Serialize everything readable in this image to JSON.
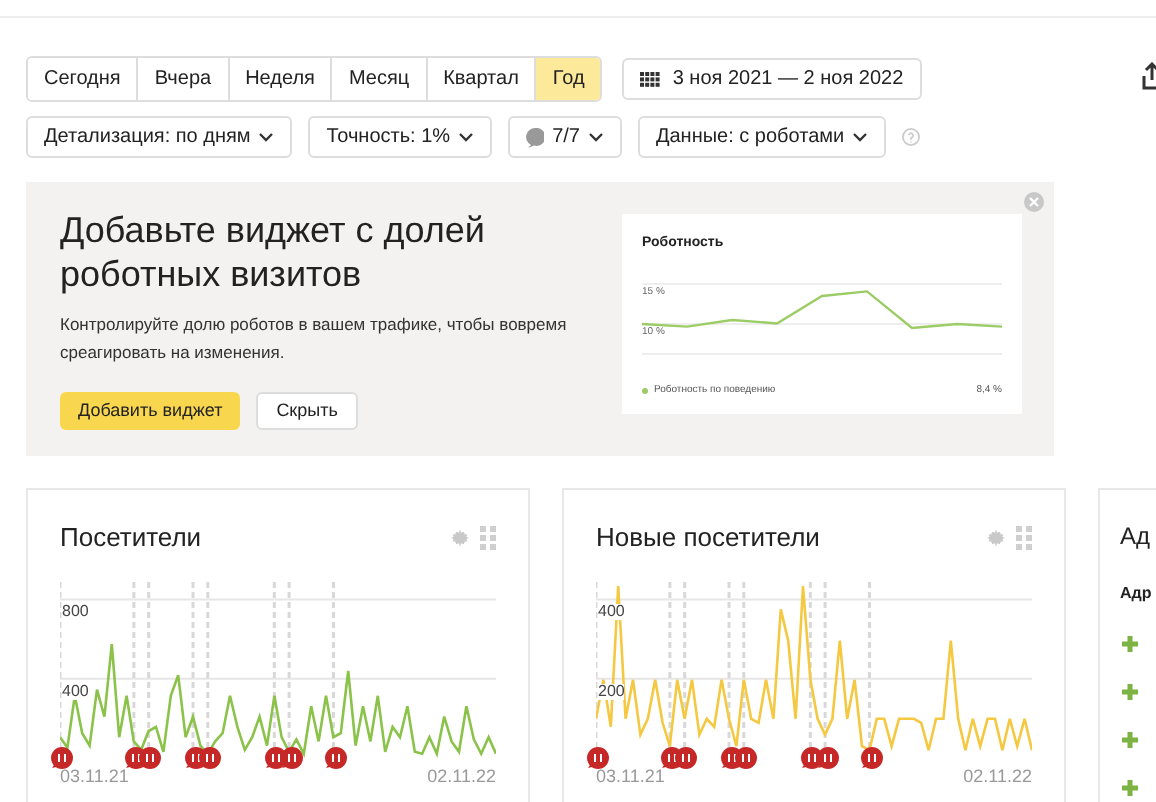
{
  "periods": [
    {
      "label": "Сегодня",
      "selected": false
    },
    {
      "label": "Вчера",
      "selected": false
    },
    {
      "label": "Неделя",
      "selected": false
    },
    {
      "label": "Месяц",
      "selected": false
    },
    {
      "label": "Квартал",
      "selected": false
    },
    {
      "label": "Год",
      "selected": true
    }
  ],
  "date_range": "3 ноя 2021 — 2 ноя 2022",
  "filters": [
    {
      "kind": "text",
      "label": "Детализация: по дням"
    },
    {
      "kind": "text",
      "label": "Точность: 1%"
    },
    {
      "kind": "segments",
      "label": "7/7"
    },
    {
      "kind": "text",
      "label": "Данные: с роботами"
    }
  ],
  "banner": {
    "title": "Добавьте виджет с долей роботных визитов",
    "text": "Контролируйте долю роботов в вашем трафике, чтобы вовремя среагировать на изменения.",
    "primary_button": "Добавить виджет",
    "secondary_button": "Скрыть",
    "preview": {
      "title": "Роботность",
      "y_labels": [
        "15 %",
        "10 %"
      ],
      "legend": "Роботность по поведению",
      "legend_value": "8,4 %"
    }
  },
  "widgets": [
    {
      "title": "Посетители",
      "y_labels": [
        "800",
        "400"
      ],
      "x_labels": [
        "03.11.21",
        "02.11.22"
      ]
    },
    {
      "title": "Новые посетители",
      "y_labels": [
        "400",
        "200"
      ],
      "x_labels": [
        "03.11.21",
        "02.11.22"
      ]
    },
    {
      "title": "Ад",
      "subtitle": "Адр",
      "rows": [
        {
          "kind": "add"
        },
        {
          "kind": "add"
        },
        {
          "kind": "add"
        },
        {
          "kind": "add"
        }
      ]
    }
  ]
}
